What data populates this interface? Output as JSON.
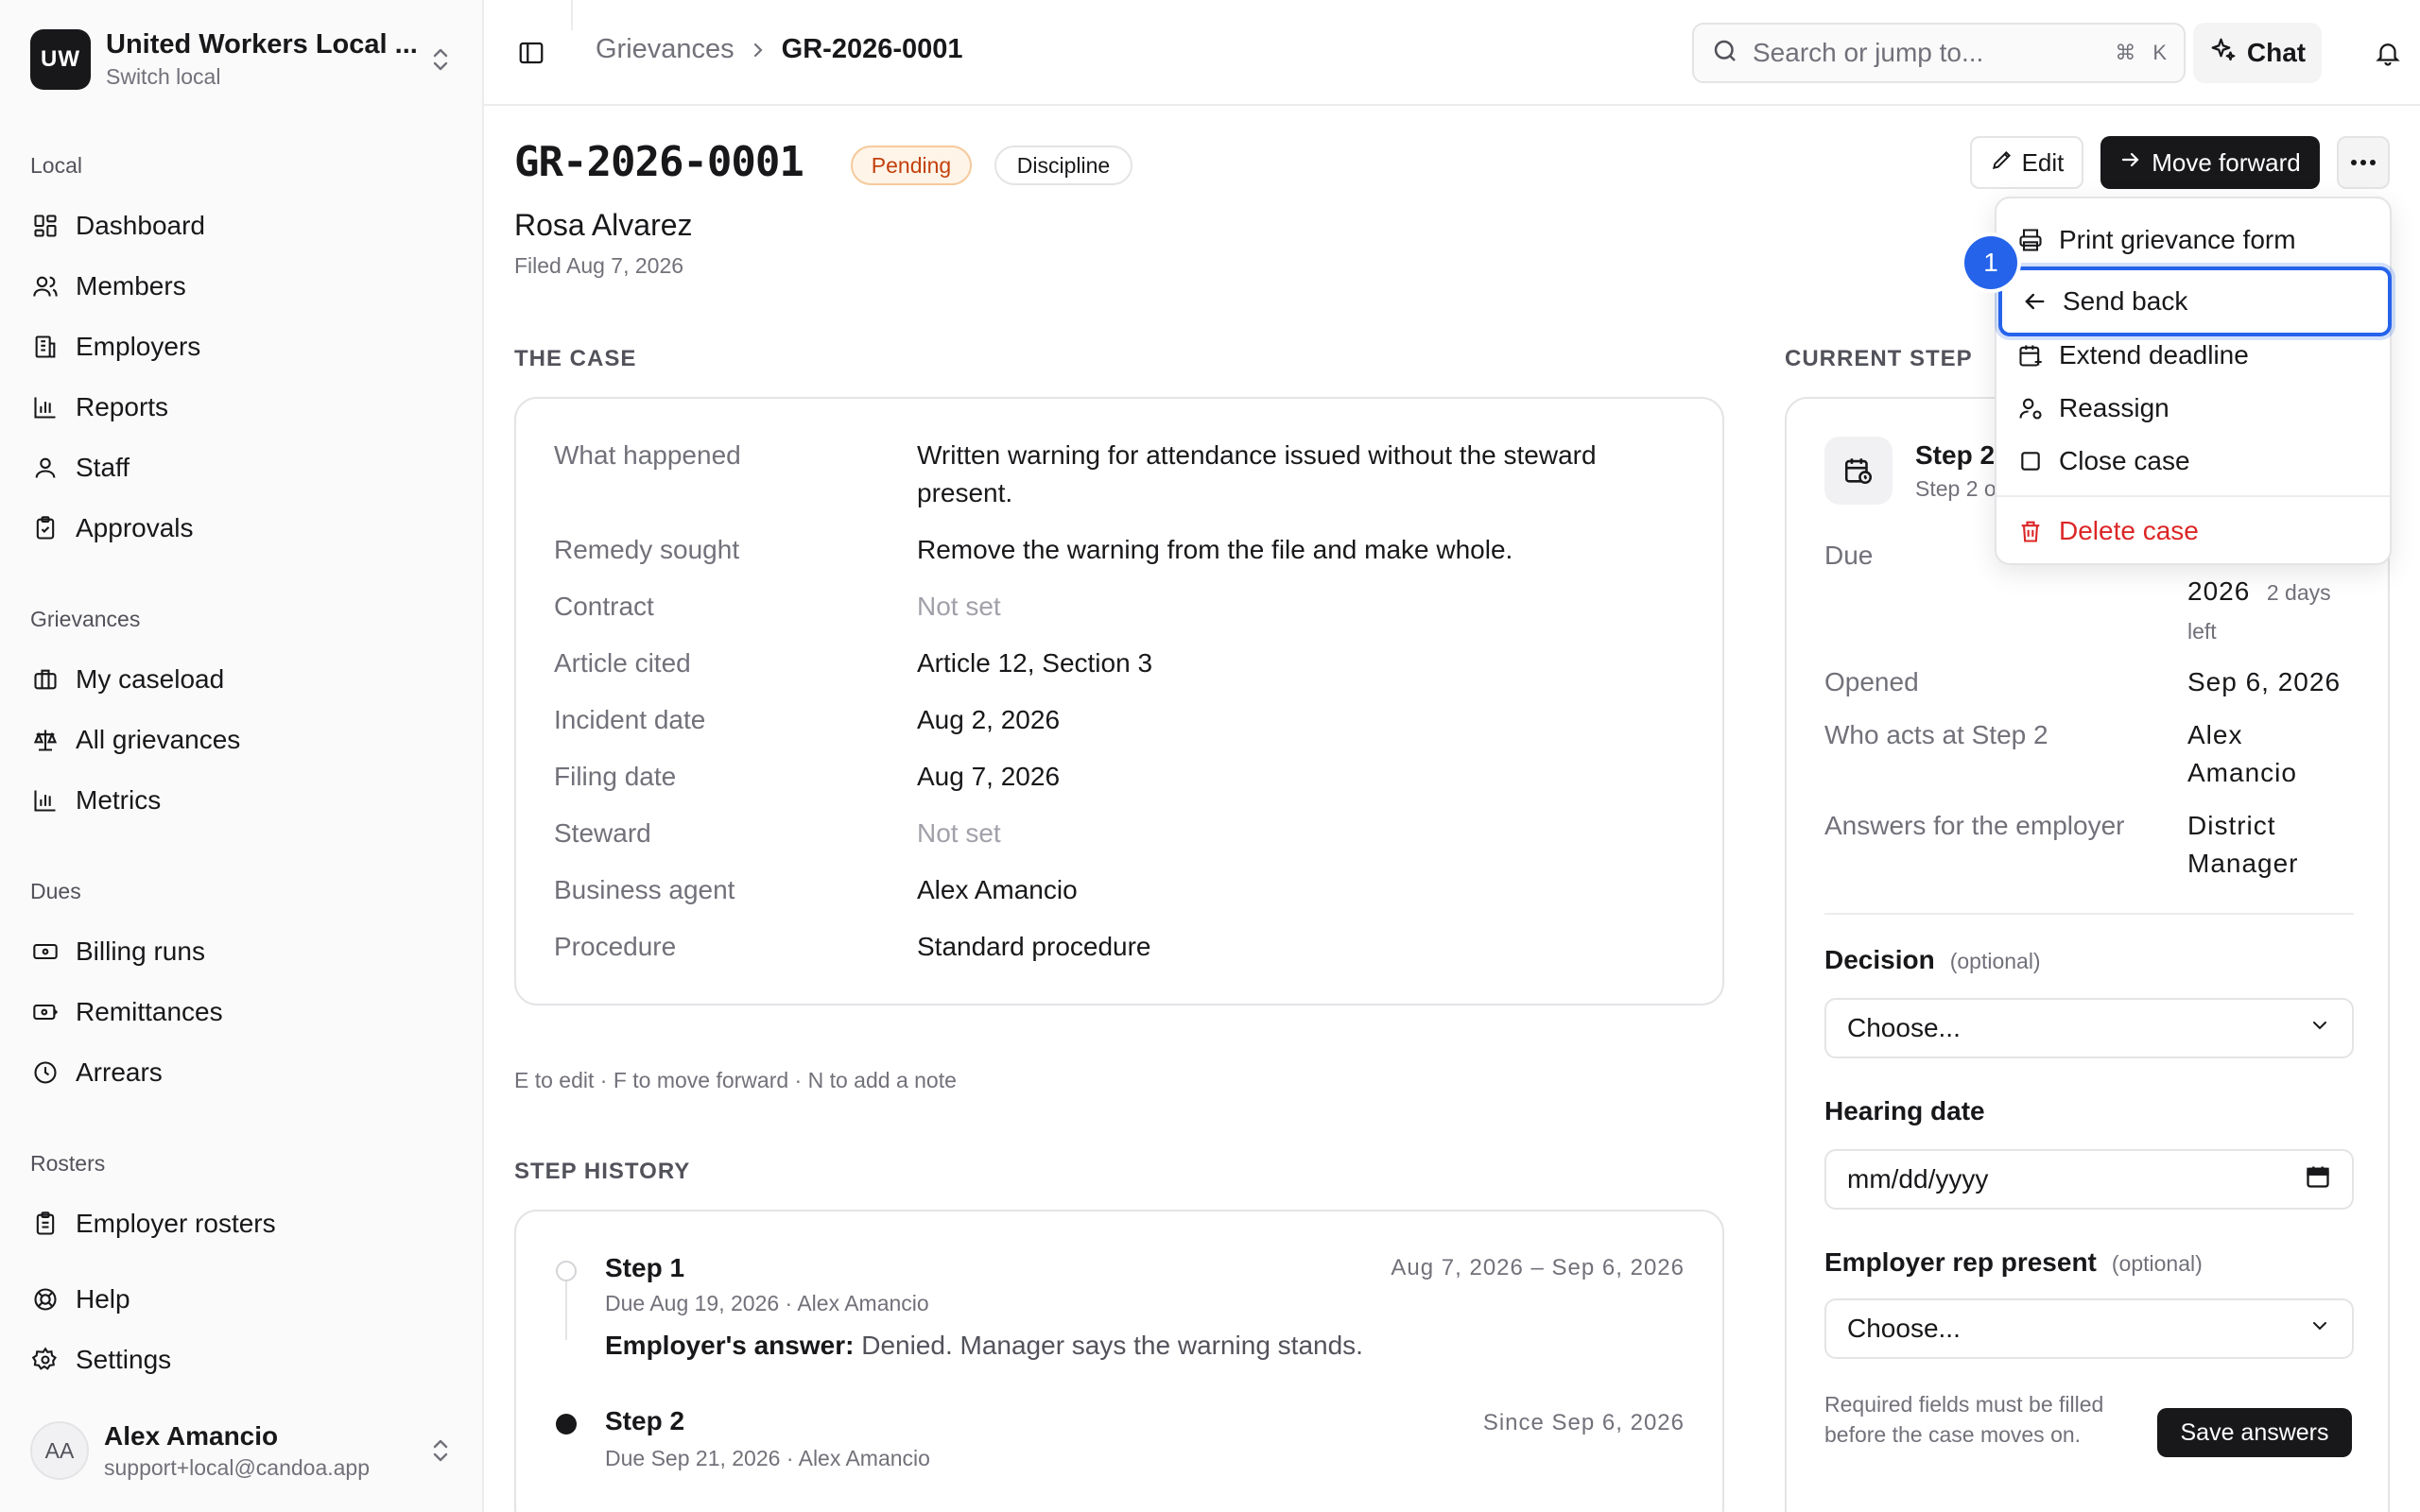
{
  "org": {
    "initials": "UW",
    "name": "United Workers Local ...",
    "switch_label": "Switch local"
  },
  "nav": {
    "sections": [
      {
        "heading": "Local",
        "items": [
          "Dashboard",
          "Members",
          "Employers",
          "Reports",
          "Staff",
          "Approvals"
        ]
      },
      {
        "heading": "Grievances",
        "items": [
          "My caseload",
          "All grievances",
          "Metrics"
        ]
      },
      {
        "heading": "Dues",
        "items": [
          "Billing runs",
          "Remittances",
          "Arrears"
        ]
      },
      {
        "heading": "Rosters",
        "items": [
          "Employer rosters"
        ]
      }
    ],
    "footer_items": [
      "Help",
      "Settings"
    ]
  },
  "user": {
    "initials": "AA",
    "name": "Alex Amancio",
    "email": "support+local@candoa.app"
  },
  "topbar": {
    "breadcrumb_parent": "Grievances",
    "breadcrumb_current": "GR-2026-0001",
    "search_placeholder": "Search or jump to...",
    "search_kbd_1": "⌘",
    "search_kbd_2": "K",
    "chat_label": "Chat"
  },
  "case": {
    "id": "GR-2026-0001",
    "status": "Pending",
    "type": "Discipline",
    "member": "Rosa Alvarez",
    "filed": "Filed Aug 7, 2026",
    "edit_label": "Edit",
    "move_label": "Move forward"
  },
  "the_case": {
    "heading": "THE CASE",
    "rows": [
      {
        "k": "What happened",
        "v": "Written warning for attendance issued without the steward present."
      },
      {
        "k": "Remedy sought",
        "v": "Remove the warning from the file and make whole."
      },
      {
        "k": "Contract",
        "v": "Not set"
      },
      {
        "k": "Article cited",
        "v": "Article 12, Section 3"
      },
      {
        "k": "Incident date",
        "v": "Aug 2, 2026"
      },
      {
        "k": "Filing date",
        "v": "Aug 7, 2026"
      },
      {
        "k": "Steward",
        "v": "Not set"
      },
      {
        "k": "Business agent",
        "v": "Alex Amancio"
      },
      {
        "k": "Procedure",
        "v": "Standard procedure"
      }
    ]
  },
  "shortcuts": "E to edit · F to move forward · N to add a note",
  "history": {
    "heading": "STEP HISTORY",
    "steps": [
      {
        "title": "Step 1",
        "sub": "Due Aug 19, 2026 · Alex Amancio",
        "dates": "Aug 7, 2026 – Sep 6, 2026",
        "answer_label": "Employer's answer:",
        "answer": " Denied. Manager says the warning stands."
      },
      {
        "title": "Step 2",
        "sub": "Due Sep 21, 2026 · Alex Amancio",
        "dates": "Since Sep 6, 2026"
      }
    ]
  },
  "current_step": {
    "heading": "CURRENT STEP",
    "title": "Step 2",
    "sub": "Step 2 o",
    "due_label": "Due",
    "due_value": "2026",
    "due_left": "2 days left",
    "opened_label": "Opened",
    "opened_value": "Sep 6, 2026",
    "who_label": "Who acts at Step 2",
    "who_value": "Alex Amancio",
    "answers_label": "Answers for the employer",
    "answers_value": "District Manager",
    "decision_label": "Decision",
    "optional": "(optional)",
    "decision_value": "Choose...",
    "hearing_label": "Hearing date",
    "hearing_value": "mm/dd/yyyy",
    "rep_label": "Employer rep present",
    "rep_value": "Choose...",
    "required_note": "Required fields must be filled before the case moves on.",
    "save_label": "Save answers"
  },
  "menu": {
    "items": [
      "Print grievance form",
      "Send back",
      "Extend deadline",
      "Reassign",
      "Close case",
      "Delete case"
    ],
    "marker": "1"
  },
  "colors": {
    "accent": "#2563eb",
    "danger": "#dc2626",
    "pending": "#c2410c"
  }
}
